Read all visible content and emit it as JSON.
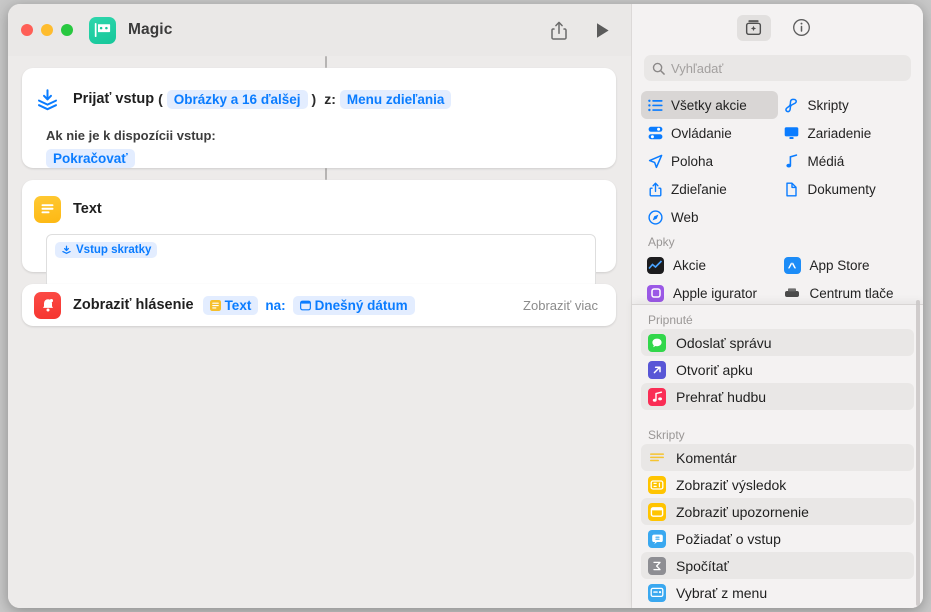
{
  "window": {
    "title": "Magic",
    "doc_icon": "shortcut-mask-icon",
    "share_icon": "share-icon",
    "run_icon": "play-icon"
  },
  "canvas": {
    "actions": [
      {
        "icon": "receive-input-icon",
        "title": "Prijať vstup",
        "paren_open": "(",
        "type_token": "Obrázky a 16 ďalšej",
        "paren_close": ")",
        "from_label": "z:",
        "source_token": "Menu zdieľania",
        "fallback_label": "Ak nie je k dispozícii vstup:",
        "fallback_token": "Pokračovať"
      },
      {
        "icon": "text-action-icon",
        "title": "Text",
        "field_token": "Vstup skratky"
      },
      {
        "icon": "notification-bell-icon",
        "title": "Zobraziť hlásenie",
        "token_text": "Text",
        "mid_label": "na:",
        "token_date": "Dnešný dátum",
        "show_more": "Zobraziť viac"
      }
    ]
  },
  "sidebar": {
    "toolbar": {
      "library_icon": "action-library-icon",
      "info_icon": "info-icon"
    },
    "search": {
      "placeholder": "Vyhľadať",
      "value": "",
      "icon": "search-icon"
    },
    "categories": [
      {
        "label": "Všetky akcie",
        "icon": "list-icon",
        "selected": true
      },
      {
        "label": "Skripty",
        "icon": "scripting-icon",
        "selected": false
      },
      {
        "label": "Ovládanie",
        "icon": "controls-icon",
        "selected": false
      },
      {
        "label": "Zariadenie",
        "icon": "display-icon",
        "selected": false
      },
      {
        "label": "Poloha",
        "icon": "location-arrow-icon",
        "selected": false
      },
      {
        "label": "Médiá",
        "icon": "music-note-icon",
        "selected": false
      },
      {
        "label": "Zdieľanie",
        "icon": "share-icon",
        "selected": false
      },
      {
        "label": "Dokumenty",
        "icon": "document-icon",
        "selected": false
      },
      {
        "label": "Web",
        "icon": "compass-icon",
        "selected": false
      }
    ],
    "apps_section": {
      "label": "Apky",
      "items": [
        {
          "label": "Akcie",
          "icon": "stocks-app-icon"
        },
        {
          "label": "App Store",
          "icon": "appstore-app-icon"
        },
        {
          "label": "Apple  igurator",
          "icon": "configurator-app-icon"
        },
        {
          "label": "Centrum tlače",
          "icon": "print-center-icon"
        }
      ]
    },
    "pinned_section": {
      "label": "Pripnuté",
      "items": [
        {
          "label": "Odoslať správu",
          "icon": "messages-icon",
          "color": "#32d74b",
          "alt": true
        },
        {
          "label": "Otvoriť apku",
          "icon": "open-app-icon",
          "color": "#5856d6",
          "alt": false
        },
        {
          "label": "Prehrať hudbu",
          "icon": "music-icon",
          "color": "#fa2d55",
          "alt": true
        }
      ]
    },
    "scripting_section": {
      "label": "Skripty",
      "items": [
        {
          "label": "Komentár",
          "icon": "comment-icon",
          "color": "#ffffff",
          "alt": true
        },
        {
          "label": "Zobraziť výsledok",
          "icon": "show-result-icon",
          "color": "#ffc400",
          "alt": false
        },
        {
          "label": "Zobraziť upozornenie",
          "icon": "show-alert-icon",
          "color": "#ffc400",
          "alt": true
        },
        {
          "label": "Požiadať o vstup",
          "icon": "ask-input-icon",
          "color": "#3aa8f0",
          "alt": false
        },
        {
          "label": "Spočítať",
          "icon": "count-icon",
          "color": "#8e8e93",
          "alt": true
        },
        {
          "label": "Vybrať z menu",
          "icon": "choose-menu-icon",
          "color": "#3aa8f0",
          "alt": false
        }
      ]
    }
  },
  "colors": {
    "accent_blue": "#0a7cff",
    "token_bg": "#e3edff",
    "window_bg": "#f2f0ef",
    "canvas_bg": "#edebea"
  }
}
